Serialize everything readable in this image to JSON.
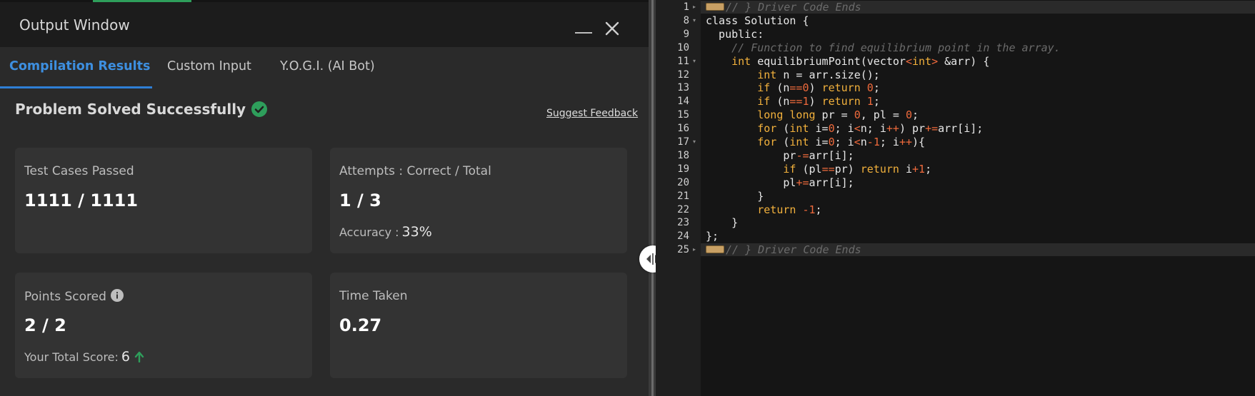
{
  "output_window": {
    "title": "Output Window",
    "tabs": [
      {
        "label": "Compilation Results",
        "active": true
      },
      {
        "label": "Custom Input",
        "active": false
      },
      {
        "label": "Y.O.G.I. (AI Bot)",
        "active": false
      }
    ],
    "status": "Problem Solved Successfully",
    "suggest_feedback": "Suggest Feedback",
    "cards": {
      "tests": {
        "label": "Test Cases Passed",
        "value": "1111 / 1111"
      },
      "attempts": {
        "label": "Attempts : Correct / Total",
        "value": "1 / 3",
        "sub_label": "Accuracy :",
        "sub_value": "33%"
      },
      "points": {
        "label": "Points Scored",
        "value": "2 / 2",
        "sub_label": "Your Total Score:",
        "sub_value": "6"
      },
      "time": {
        "label": "Time Taken",
        "value": "0.27"
      }
    }
  },
  "editor": {
    "line_numbers": [
      "1",
      "8",
      "9",
      "10",
      "11",
      "12",
      "13",
      "14",
      "15",
      "16",
      "17",
      "18",
      "19",
      "20",
      "21",
      "22",
      "23",
      "24",
      "25"
    ],
    "lines": [
      "// } Driver Code Ends",
      "class Solution {",
      "  public:",
      "    // Function to find equilibrium point in the array.",
      "    int equilibriumPoint(vector<int> &arr) {",
      "        int n = arr.size();",
      "        if (n==0) return 0;",
      "        if (n==1) return 1;",
      "        long long pr = 0, pl = 0;",
      "        for (int i=0; i<n; i++) pr+=arr[i];",
      "        for (int i=0; i<n-1; i++){",
      "            pr-=arr[i];",
      "            if (pl==pr) return i+1;",
      "            pl+=arr[i];",
      "        }",
      "        return -1;",
      "    }",
      "};",
      "// } Driver Code Ends"
    ]
  },
  "colors": {
    "accent_blue": "#2f7fd6",
    "success_green": "#2e9e5b",
    "keyword_orange": "#f2b13c",
    "number_red": "#f06a3c"
  },
  "icons": [
    "minimize-icon",
    "close-icon",
    "check-circle-icon",
    "info-icon",
    "arrow-up-icon",
    "resize-handle-icon",
    "fold-widget-icon"
  ]
}
